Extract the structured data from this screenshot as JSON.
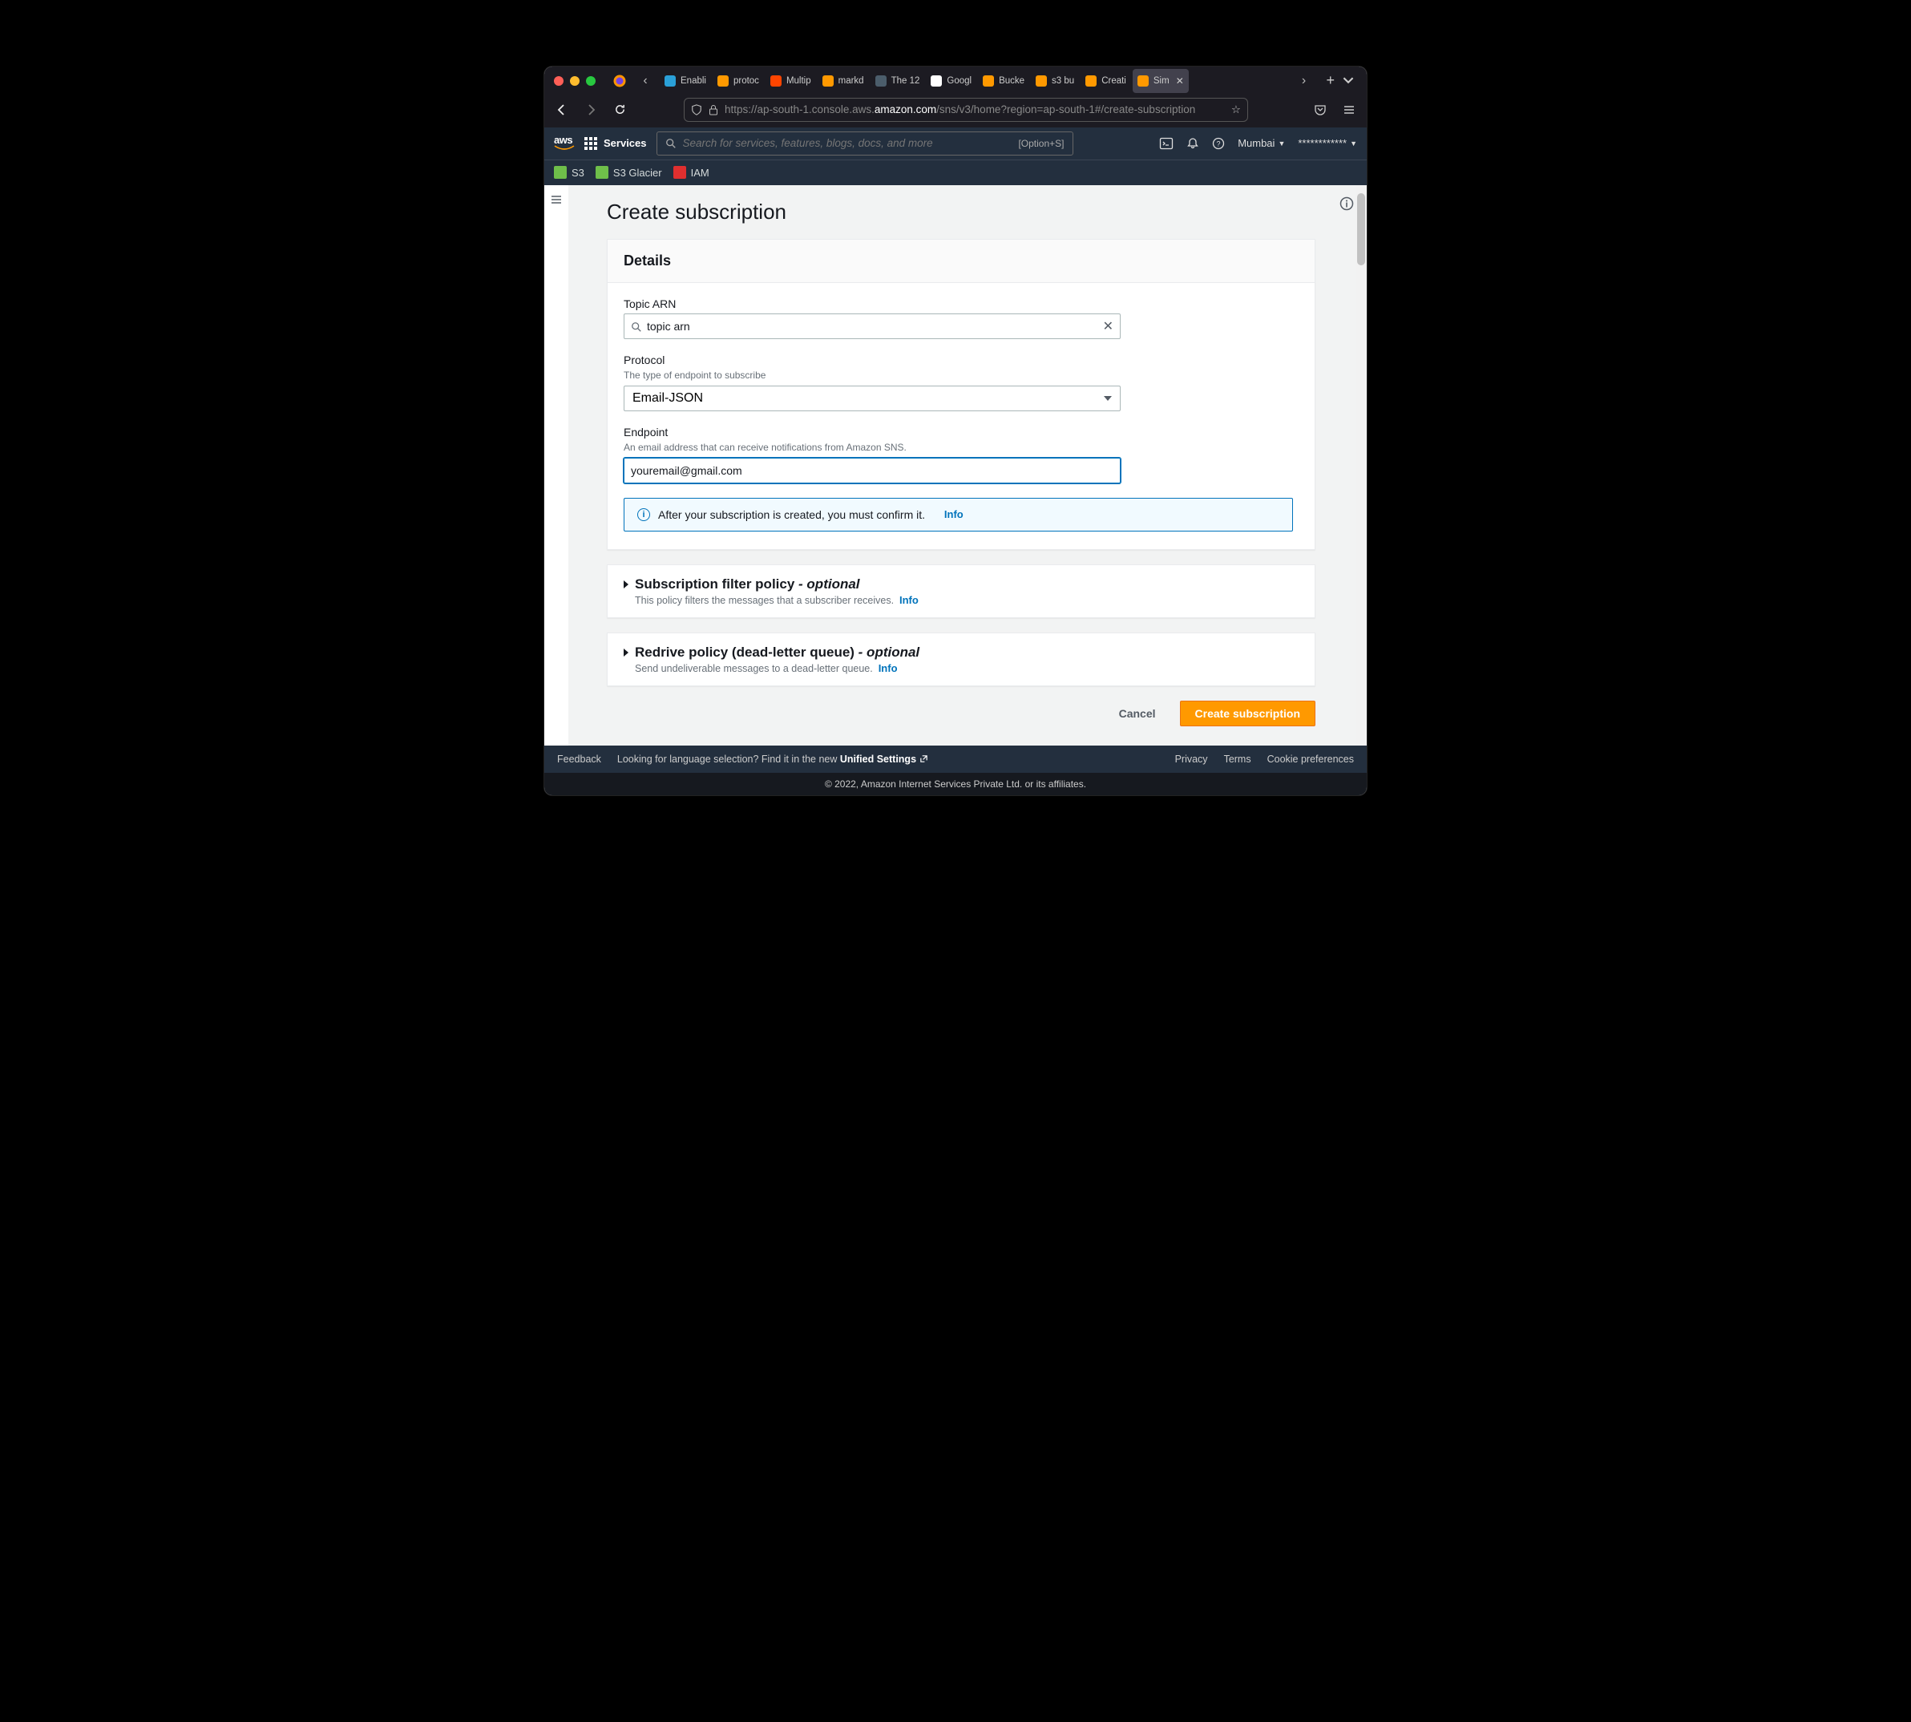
{
  "browser": {
    "tabs": [
      {
        "label": "Enabli",
        "favicon": "#2aa0d8"
      },
      {
        "label": "protoc",
        "favicon": "#ff9900"
      },
      {
        "label": "Multip",
        "favicon": "#ff4500"
      },
      {
        "label": "markd",
        "favicon": "#ff9900"
      },
      {
        "label": "The 12",
        "favicon": "#4b5d6b"
      },
      {
        "label": "Googl",
        "favicon": "#ffffff"
      },
      {
        "label": "Bucke",
        "favicon": "#ff9900"
      },
      {
        "label": "s3 bu",
        "favicon": "#ff9900"
      },
      {
        "label": "Creati",
        "favicon": "#ff9900"
      },
      {
        "label": "Sim",
        "favicon": "#ff9900",
        "active": true
      }
    ],
    "url_prefix": "https://ap-south-1.console.aws.",
    "url_domain": "amazon.com",
    "url_suffix": "/sns/v3/home?region=ap-south-1#/create-subscription"
  },
  "aws_header": {
    "services": "Services",
    "search_placeholder": "Search for services, features, blogs, docs, and more",
    "shortcut": "[Option+S]",
    "region": "Mumbai",
    "account": "************"
  },
  "aws_subnav": {
    "items": [
      {
        "label": "S3",
        "color": "#6fbf4a"
      },
      {
        "label": "S3 Glacier",
        "color": "#6fbf4a"
      },
      {
        "label": "IAM",
        "color": "#e02f2f"
      }
    ]
  },
  "page": {
    "title": "Create subscription",
    "details": {
      "heading": "Details",
      "topic_arn": {
        "label": "Topic ARN",
        "value": "topic arn"
      },
      "protocol": {
        "label": "Protocol",
        "help": "The type of endpoint to subscribe",
        "value": "Email-JSON"
      },
      "endpoint": {
        "label": "Endpoint",
        "help": "An email address that can receive notifications from Amazon SNS.",
        "value": "youremail@gmail.com"
      },
      "alert": "After your subscription is created, you must confirm it.",
      "info": "Info"
    },
    "filter_policy": {
      "title": "Subscription filter policy",
      "optional_label": " - optional",
      "help": "This policy filters the messages that a subscriber receives.",
      "info": "Info"
    },
    "redrive_policy": {
      "title": "Redrive policy (dead-letter queue)",
      "optional_label": " - optional",
      "help": "Send undeliverable messages to a dead-letter queue.",
      "info": "Info"
    },
    "actions": {
      "cancel": "Cancel",
      "create": "Create subscription"
    }
  },
  "footer": {
    "feedback": "Feedback",
    "lang_prompt": "Looking for language selection? Find it in the new ",
    "unified": "Unified Settings",
    "privacy": "Privacy",
    "terms": "Terms",
    "cookie": "Cookie preferences",
    "copyright": "© 2022, Amazon Internet Services Private Ltd. or its affiliates."
  }
}
